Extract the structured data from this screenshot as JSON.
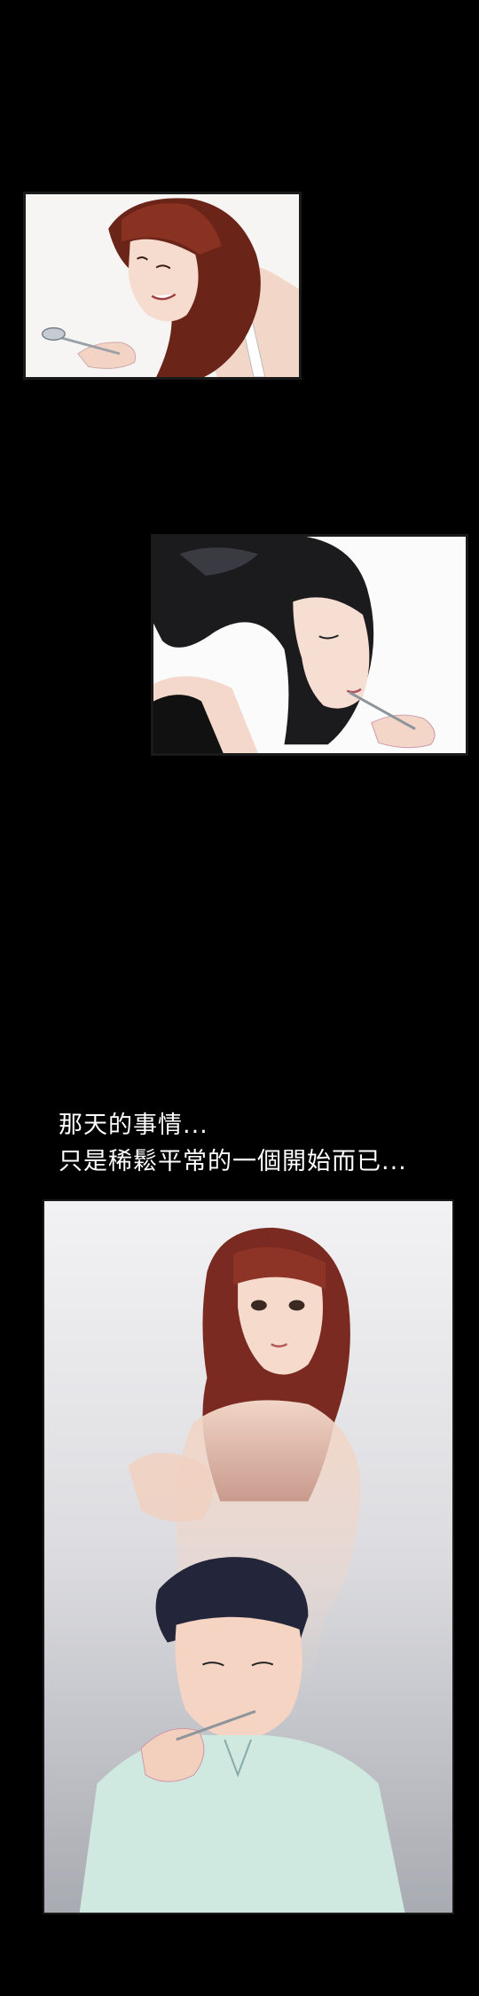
{
  "narration": {
    "line1": "那天的事情...",
    "line2": "只是稀鬆平常的一個開始而已..."
  },
  "colors": {
    "background": "#000000",
    "caption_text": "#ffffff"
  }
}
